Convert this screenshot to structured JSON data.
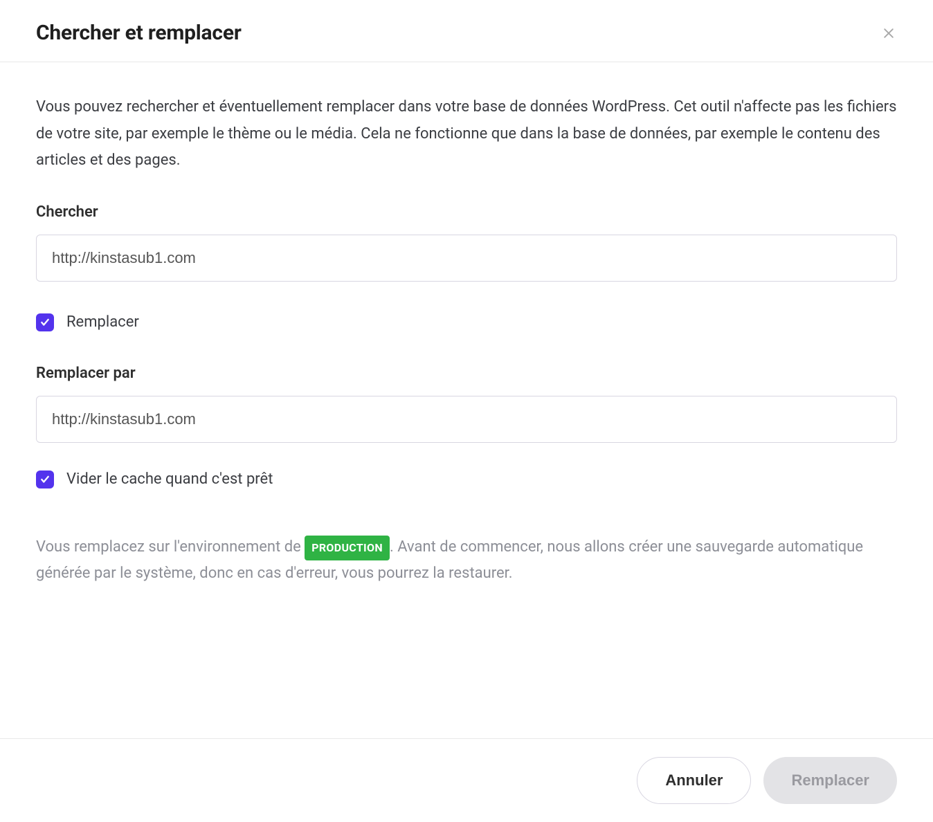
{
  "header": {
    "title": "Chercher et remplacer"
  },
  "body": {
    "description": "Vous pouvez rechercher et éventuellement remplacer dans votre base de données WordPress. Cet outil n'affecte pas les fichiers de votre site, par exemple le thème ou le média. Cela ne fonctionne que dans la base de données, par exemple le contenu des articles et des pages.",
    "search_label": "Chercher",
    "search_value": "http://kinstasub1.com",
    "replace_checkbox_label": "Remplacer",
    "replace_checked": true,
    "replace_with_label": "Remplacer par",
    "replace_with_value": "http://kinstasub1.com",
    "clear_cache_label": "Vider le cache quand c'est prêt",
    "clear_cache_checked": true,
    "notice_before": "Vous remplacez sur l'environnement de ",
    "notice_badge": "PRODUCTION",
    "notice_after": ". Avant de commencer, nous allons créer une sauvegarde automatique générée par le système, donc en cas d'erreur, vous pourrez la restaurer."
  },
  "footer": {
    "cancel": "Annuler",
    "replace": "Remplacer"
  }
}
